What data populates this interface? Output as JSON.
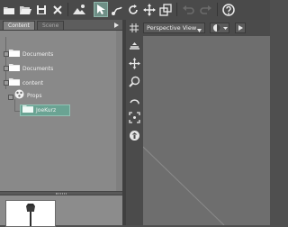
{
  "toolbar": {
    "icons": [
      "folder-icon",
      "open-folder-icon",
      "save-icon",
      "close-icon",
      "render-icon",
      "select-icon",
      "tool-icon",
      "rotate-icon",
      "move-icon",
      "scale-icon",
      "undo-icon",
      "redo-icon",
      "help-icon"
    ],
    "active_tool": "select-icon"
  },
  "content_panel": {
    "tabs": [
      "Content",
      "Scene"
    ],
    "active_tab": "Content",
    "tree": [
      {
        "label": "Documents",
        "icon": "folder-icon",
        "level": 0
      },
      {
        "label": "Documents",
        "icon": "folder-icon",
        "level": 0
      },
      {
        "label": "content",
        "icon": "folder-icon",
        "level": 0
      },
      {
        "label": "Props",
        "icon": "props-icon",
        "level": 1
      },
      {
        "label": "JoeKurz",
        "icon": "folder-icon",
        "level": 2,
        "selected": true
      }
    ]
  },
  "viewport": {
    "view_label": "Perspective View",
    "side_tools": [
      "pan-icon",
      "move-icon",
      "zoom-icon",
      "orbit-icon",
      "frame-icon",
      "camera-icon"
    ]
  },
  "colors": {
    "accent": "#6aa393",
    "toolbar_bg": "#4a4a4a",
    "panel_bg": "#898989",
    "viewport_bg": "#6e6e6e"
  }
}
